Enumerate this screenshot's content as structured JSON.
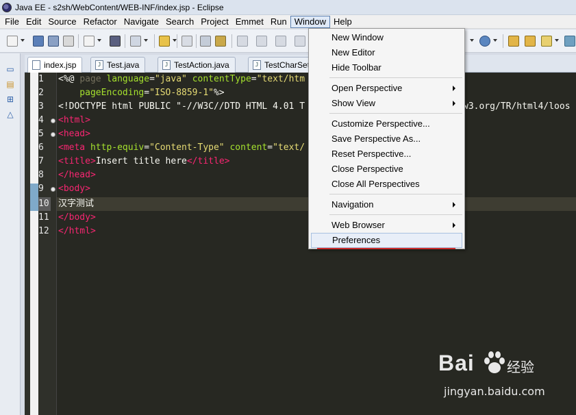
{
  "window": {
    "title": "Java EE - s2sh/WebContent/WEB-INF/index.jsp - Eclipse"
  },
  "menubar": {
    "items": [
      "File",
      "Edit",
      "Source",
      "Refactor",
      "Navigate",
      "Search",
      "Project",
      "Emmet",
      "Run",
      "Window",
      "Help"
    ],
    "active": "Window"
  },
  "tabs": [
    {
      "label": "index.jsp",
      "active": true
    },
    {
      "label": "Test.java",
      "active": false
    },
    {
      "label": "TestAction.java",
      "active": false
    },
    {
      "label": "TestCharSet",
      "active": false
    }
  ],
  "editor": {
    "line_numbers": [
      "1",
      "2",
      "3",
      "4",
      "5",
      "6",
      "7",
      "8",
      "9",
      "10",
      "11",
      "12"
    ],
    "current_line": "10",
    "lines": {
      "l1": {
        "p1": "<%@ ",
        "p2": "page ",
        "p3": "language",
        "p4": "=",
        "p5": "\"java\"",
        "p6": " contentType",
        "p7": "=",
        "p8": "\"text/htm"
      },
      "l2": {
        "p1": "    pageEncoding",
        "p2": "=",
        "p3": "\"ISO-8859-1\"",
        "p4": "%>"
      },
      "l3": {
        "p1": "<!DOCTYPE html PUBLIC \"-//W3C//DTD HTML 4.01 T",
        "p2": "w3.org/TR/html4/loos"
      },
      "l4": {
        "p1": "<",
        "p2": "html",
        "p3": ">"
      },
      "l5": {
        "p1": "<",
        "p2": "head",
        "p3": ">"
      },
      "l6": {
        "p1": "<",
        "p2": "meta",
        "p3": " http-equiv",
        "p4": "=",
        "p5": "\"Content-Type\"",
        "p6": " content",
        "p7": "=",
        "p8": "\"text/"
      },
      "l7": {
        "p1": "<",
        "p2": "title",
        "p3": ">",
        "p4": "Insert title here",
        "p5": "</",
        "p6": "title",
        "p7": ">"
      },
      "l8": {
        "p1": "</",
        "p2": "head",
        "p3": ">"
      },
      "l9": {
        "p1": "<",
        "p2": "body",
        "p3": ">"
      },
      "l10": {
        "p1": "汉字测试"
      },
      "l11": {
        "p1": "</",
        "p2": "body",
        "p3": ">"
      },
      "l12": {
        "p1": "</",
        "p2": "html",
        "p3": ">"
      }
    }
  },
  "window_menu": {
    "new_window": "New Window",
    "new_editor": "New Editor",
    "hide_toolbar": "Hide Toolbar",
    "open_perspective": "Open Perspective",
    "show_view": "Show View",
    "customize_perspective": "Customize Perspective...",
    "save_perspective_as": "Save Perspective As...",
    "reset_perspective": "Reset Perspective...",
    "close_perspective": "Close Perspective",
    "close_all_perspectives": "Close All Perspectives",
    "navigation": "Navigation",
    "web_browser": "Web Browser",
    "preferences": "Preferences"
  },
  "watermark": {
    "logo": "Bai",
    "logo_tail": "经验",
    "url": "jingyan.baidu.com"
  },
  "colors": {
    "editor_bg": "#272822",
    "tag": "#f92672",
    "attr": "#a6e22e",
    "string": "#e6db74",
    "menu_highlight": "#e8eef8"
  }
}
